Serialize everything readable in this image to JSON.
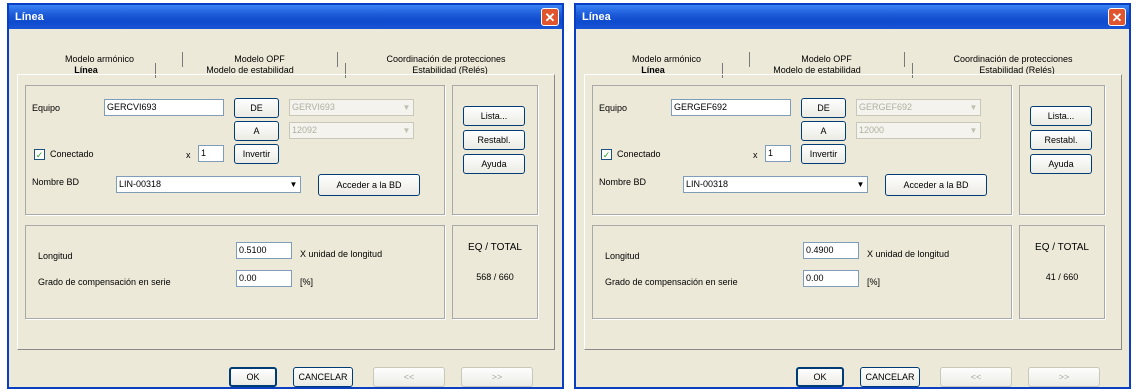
{
  "windows": [
    {
      "title": "Línea",
      "tabs_row1": [
        "Modelo armónico",
        "Modelo OPF",
        "Coordinación de protecciones"
      ],
      "tabs_row2": [
        "Línea",
        "Modelo de estabilidad",
        "Estabilidad (Relés)"
      ],
      "equipo_label": "Equipo",
      "equipo_value": "GERCVI693",
      "de_button": "DE",
      "a_button": "A",
      "de_combo": "GERVI693",
      "a_combo": "12092",
      "conectado_label": "Conectado",
      "conectado_check": "✓",
      "x_label": "x",
      "multiplier": "1",
      "invertir_button": "Invertir",
      "nombre_bd_label": "Nombre BD",
      "nombre_bd_value": "LIN-00318",
      "acceder_button": "Acceder a la BD",
      "lista_button": "Lista...",
      "restabl_button": "Restabl.",
      "ayuda_button": "Ayuda",
      "longitud_label": "Longitud",
      "longitud_value": "0.5100",
      "longitud_unit": "X unidad de longitud",
      "grado_label": "Grado de compensación en serie",
      "grado_value": "0.00",
      "grado_unit": "[%]",
      "eq_total_label": "EQ / TOTAL",
      "eq_total_value": "568 / 660",
      "ok_button": "OK",
      "cancelar_button": "CANCELAR",
      "prev_button": "<<",
      "next_button": ">>"
    },
    {
      "title": "Línea",
      "tabs_row1": [
        "Modelo armónico",
        "Modelo OPF",
        "Coordinación de protecciones"
      ],
      "tabs_row2": [
        "Línea",
        "Modelo de estabilidad",
        "Estabilidad (Relés)"
      ],
      "equipo_label": "Equipo",
      "equipo_value": "GERGEF692",
      "de_button": "DE",
      "a_button": "A",
      "de_combo": "GERGEF692",
      "a_combo": "12000",
      "conectado_label": "Conectado",
      "conectado_check": "✓",
      "x_label": "x",
      "multiplier": "1",
      "invertir_button": "Invertir",
      "nombre_bd_label": "Nombre BD",
      "nombre_bd_value": "LIN-00318",
      "acceder_button": "Acceder a la BD",
      "lista_button": "Lista...",
      "restabl_button": "Restabl.",
      "ayuda_button": "Ayuda",
      "longitud_label": "Longitud",
      "longitud_value": "0.4900",
      "longitud_unit": "X unidad de longitud",
      "grado_label": "Grado de compensación en serie",
      "grado_value": "0.00",
      "grado_unit": "[%]",
      "eq_total_label": "EQ / TOTAL",
      "eq_total_value": "41 / 660",
      "ok_button": "OK",
      "cancelar_button": "CANCELAR",
      "prev_button": "<<",
      "next_button": ">>"
    }
  ]
}
